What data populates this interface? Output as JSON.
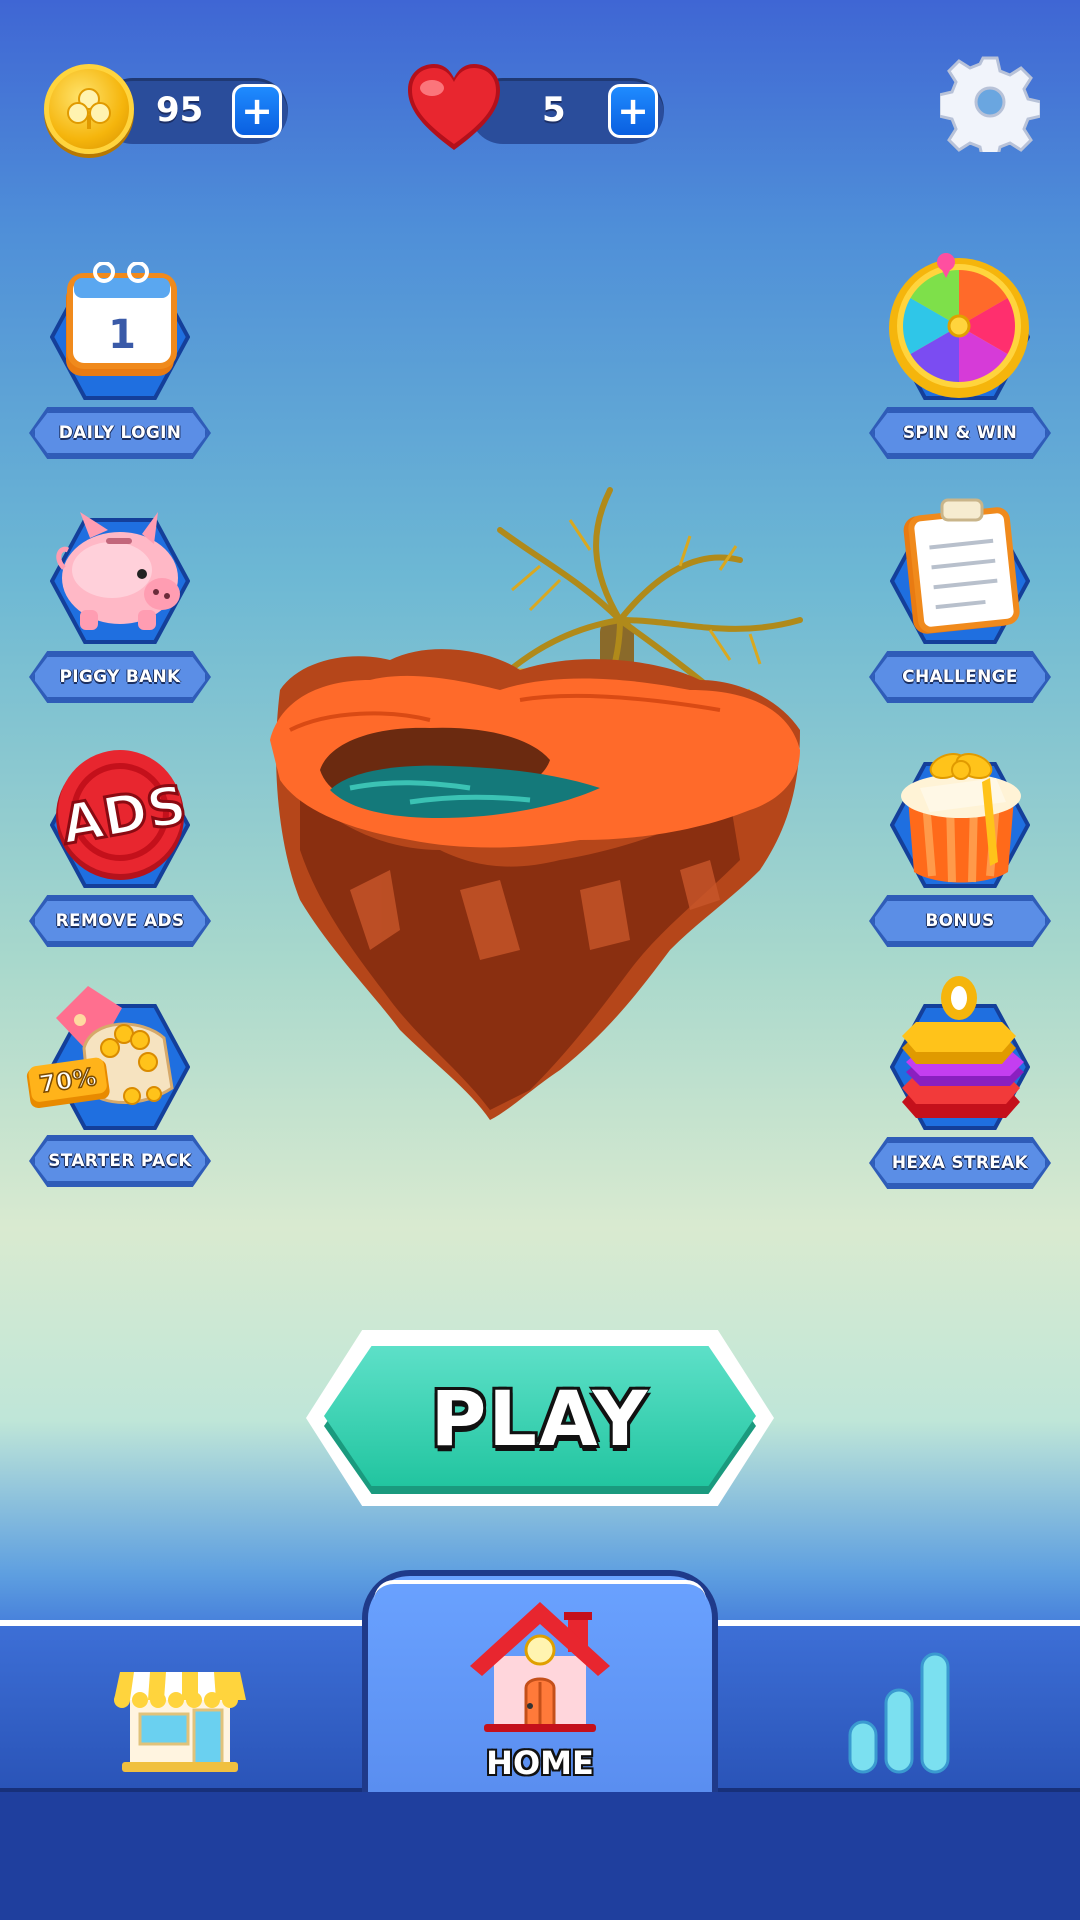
{
  "currency": {
    "coins": {
      "value": "95",
      "add_label": "+"
    },
    "lives": {
      "value": "5",
      "add_label": "+"
    }
  },
  "settings": {
    "icon": "gear-icon"
  },
  "left_features": [
    {
      "label": "DAILY LOGIN",
      "icon": "calendar-icon"
    },
    {
      "label": "PIGGY BANK",
      "icon": "piggy-bank-icon"
    },
    {
      "label": "REMOVE ADS",
      "icon": "ads-icon"
    },
    {
      "label": "STARTER PACK",
      "icon": "starter-pack-icon"
    }
  ],
  "right_features": [
    {
      "label": "SPIN & WIN",
      "icon": "prize-wheel-icon"
    },
    {
      "label": "CHALLENGE",
      "icon": "clipboard-icon"
    },
    {
      "label": "BONUS",
      "icon": "gift-box-icon"
    },
    {
      "label": "HEXA STREAK",
      "icon": "hexa-stack-icon"
    }
  ],
  "calendar_day": "1",
  "ads_text": "ADS",
  "starter_discount": "70%",
  "play_button": {
    "label": "PLAY"
  },
  "bottom_nav": {
    "shop": {
      "icon": "shop-icon"
    },
    "home": {
      "label": "HOME",
      "icon": "home-icon"
    },
    "leaderboard": {
      "icon": "leaderboard-icon"
    }
  },
  "colors": {
    "accent_blue": "#5b8ee6",
    "play_green": "#22c5a0",
    "coin_gold": "#f5b50c",
    "heart_red": "#e8262f"
  }
}
